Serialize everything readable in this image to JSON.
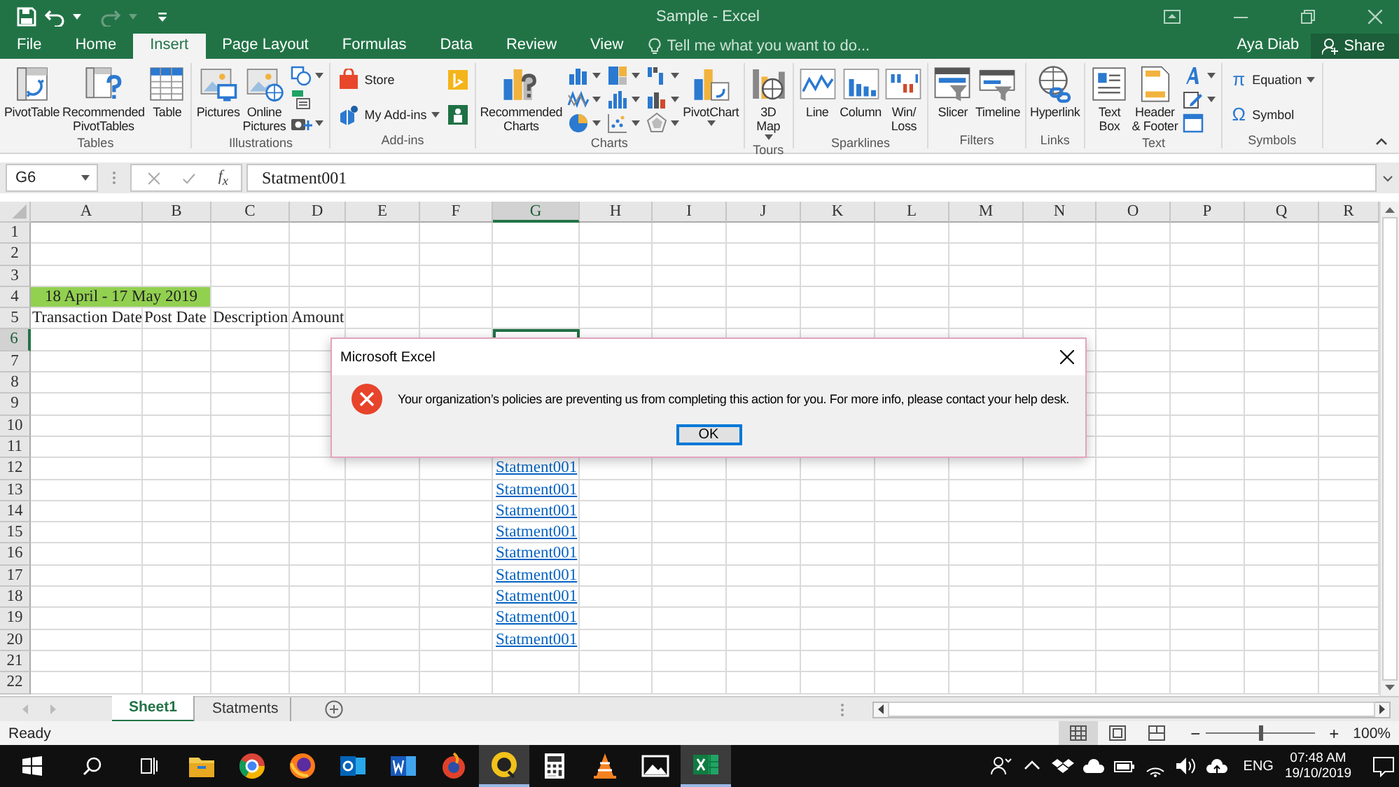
{
  "title_bar": {
    "title": "Sample - Excel"
  },
  "tabs": [
    {
      "label": "File",
      "selected": false
    },
    {
      "label": "Home",
      "selected": false
    },
    {
      "label": "Insert",
      "selected": true
    },
    {
      "label": "Page Layout",
      "selected": false
    },
    {
      "label": "Formulas",
      "selected": false
    },
    {
      "label": "Data",
      "selected": false
    },
    {
      "label": "Review",
      "selected": false
    },
    {
      "label": "View",
      "selected": false
    }
  ],
  "tell_me": {
    "placeholder": "Tell me what you want to do..."
  },
  "user": {
    "name": "Aya Diab",
    "share": "Share"
  },
  "ribbon": {
    "groups": [
      {
        "label": "Tables",
        "buttons": [
          {
            "kind": "large",
            "label": "PivotTable"
          },
          {
            "kind": "large",
            "label": "Recommended\nPivotTables"
          },
          {
            "kind": "large",
            "label": "Table"
          }
        ]
      },
      {
        "label": "Illustrations",
        "buttons": [
          {
            "kind": "large",
            "label": "Pictures"
          },
          {
            "kind": "large",
            "label": "Online\nPictures"
          },
          {
            "kind": "stack",
            "items": [
              {
                "kind": "icon",
                "dropdown": true
              },
              {
                "kind": "icon",
                "dropdown": false
              },
              {
                "kind": "icon",
                "dropdown": true
              }
            ]
          }
        ]
      },
      {
        "label": "Add-ins",
        "buttons": [
          {
            "kind": "stack",
            "items": [
              {
                "kind": "small",
                "label": "Store",
                "dropdown": false
              },
              {
                "kind": "small",
                "label": "My Add-ins",
                "dropdown": true
              }
            ]
          },
          {
            "kind": "stack",
            "items": [
              {
                "kind": "icon",
                "dropdown": false
              },
              {
                "kind": "icon",
                "dropdown": false
              }
            ]
          }
        ]
      },
      {
        "label": "Charts",
        "buttons": [
          {
            "kind": "large",
            "label": "Recommended\nCharts"
          },
          {
            "kind": "stack",
            "items": [
              {
                "kind": "icon",
                "dropdown": true
              },
              {
                "kind": "icon",
                "dropdown": true
              },
              {
                "kind": "icon",
                "dropdown": true
              }
            ]
          },
          {
            "kind": "stack",
            "items": [
              {
                "kind": "icon",
                "dropdown": true
              },
              {
                "kind": "icon",
                "dropdown": true
              },
              {
                "kind": "icon",
                "dropdown": true
              }
            ]
          },
          {
            "kind": "stack",
            "items": [
              {
                "kind": "icon",
                "dropdown": true
              },
              {
                "kind": "icon",
                "dropdown": true
              },
              {
                "kind": "icon",
                "dropdown": true
              }
            ]
          },
          {
            "kind": "large",
            "label": "PivotChart",
            "dropdown": true
          }
        ]
      },
      {
        "label": "Tours",
        "buttons": [
          {
            "kind": "large",
            "label": "3D\nMap",
            "dropdown": true
          }
        ]
      },
      {
        "label": "Sparklines",
        "buttons": [
          {
            "kind": "large",
            "label": "Line"
          },
          {
            "kind": "large",
            "label": "Column"
          },
          {
            "kind": "large",
            "label": "Win/\nLoss"
          }
        ]
      },
      {
        "label": "Filters",
        "buttons": [
          {
            "kind": "large",
            "label": "Slicer"
          },
          {
            "kind": "large",
            "label": "Timeline"
          }
        ]
      },
      {
        "label": "Links",
        "buttons": [
          {
            "kind": "large",
            "label": "Hyperlink"
          }
        ]
      },
      {
        "label": "Text",
        "buttons": [
          {
            "kind": "large",
            "label": "Text\nBox"
          },
          {
            "kind": "large",
            "label": "Header\n& Footer"
          },
          {
            "kind": "stack",
            "items": [
              {
                "kind": "icon",
                "dropdown": true
              },
              {
                "kind": "icon",
                "dropdown": true
              },
              {
                "kind": "icon",
                "dropdown": false
              }
            ]
          }
        ]
      },
      {
        "label": "Symbols",
        "buttons": [
          {
            "kind": "stack",
            "items": [
              {
                "kind": "small",
                "glyph": "π",
                "label": "Equation",
                "dropdown": true
              },
              {
                "kind": "small",
                "glyph": "Ω",
                "label": "Symbol",
                "dropdown": false
              }
            ]
          }
        ]
      }
    ]
  },
  "formula_bar": {
    "name_box": "G6",
    "fx": "f$_{x}$",
    "value": "Statment001"
  },
  "grid": {
    "columns": [
      {
        "label": "A",
        "selected": false
      },
      {
        "label": "B",
        "selected": false
      },
      {
        "label": "C",
        "selected": false
      },
      {
        "label": "D",
        "selected": false
      },
      {
        "label": "E",
        "selected": false
      },
      {
        "label": "F",
        "selected": false
      },
      {
        "label": "G",
        "selected": true
      },
      {
        "label": "H",
        "selected": false
      },
      {
        "label": "I",
        "selected": false
      },
      {
        "label": "J",
        "selected": false
      },
      {
        "label": "K",
        "selected": false
      },
      {
        "label": "L",
        "selected": false
      },
      {
        "label": "M",
        "selected": false
      },
      {
        "label": "N",
        "selected": false
      },
      {
        "label": "O",
        "selected": false
      },
      {
        "label": "P",
        "selected": false
      },
      {
        "label": "Q",
        "selected": false
      },
      {
        "label": "R",
        "selected": false
      }
    ],
    "rows": [
      {
        "label": "1",
        "selected": false,
        "cells": {}
      },
      {
        "label": "2",
        "selected": false,
        "cells": {}
      },
      {
        "label": "3",
        "selected": false,
        "cells": {}
      },
      {
        "label": "4",
        "selected": false,
        "cells": {
          "A": {
            "kind": "banner",
            "text": "18 April - 17 May 2019",
            "selected": false
          }
        }
      },
      {
        "label": "5",
        "selected": false,
        "cells": {
          "A": {
            "kind": "text",
            "text": "Transaction Date",
            "selected": false
          },
          "B": {
            "kind": "text",
            "text": "Post Date",
            "selected": false
          },
          "C": {
            "kind": "text",
            "text": "Description",
            "selected": false
          },
          "D": {
            "kind": "text",
            "text": "Amount",
            "selected": false
          }
        }
      },
      {
        "label": "6",
        "selected": true,
        "cells": {
          "G": {
            "kind": "empty",
            "selected": true
          }
        }
      },
      {
        "label": "7",
        "selected": false,
        "cells": {}
      },
      {
        "label": "8",
        "selected": false,
        "cells": {}
      },
      {
        "label": "9",
        "selected": false,
        "cells": {}
      },
      {
        "label": "10",
        "selected": false,
        "cells": {}
      },
      {
        "label": "11",
        "selected": false,
        "cells": {}
      },
      {
        "label": "12",
        "selected": false,
        "cells": {
          "G": {
            "kind": "link",
            "text": "Statment001",
            "selected": false
          }
        }
      },
      {
        "label": "13",
        "selected": false,
        "cells": {
          "G": {
            "kind": "link",
            "text": "Statment001",
            "selected": false
          }
        }
      },
      {
        "label": "14",
        "selected": false,
        "cells": {
          "G": {
            "kind": "link",
            "text": "Statment001",
            "selected": false
          }
        }
      },
      {
        "label": "15",
        "selected": false,
        "cells": {
          "G": {
            "kind": "link",
            "text": "Statment001",
            "selected": false
          }
        }
      },
      {
        "label": "16",
        "selected": false,
        "cells": {
          "G": {
            "kind": "link",
            "text": "Statment001",
            "selected": false
          }
        }
      },
      {
        "label": "17",
        "selected": false,
        "cells": {
          "G": {
            "kind": "link",
            "text": "Statment001",
            "selected": false
          }
        }
      },
      {
        "label": "18",
        "selected": false,
        "cells": {
          "G": {
            "kind": "link",
            "text": "Statment001",
            "selected": false
          }
        }
      },
      {
        "label": "19",
        "selected": false,
        "cells": {
          "G": {
            "kind": "link",
            "text": "Statment001",
            "selected": false
          }
        }
      },
      {
        "label": "20",
        "selected": false,
        "cells": {
          "G": {
            "kind": "link",
            "text": "Statment001",
            "selected": false
          }
        }
      },
      {
        "label": "21",
        "selected": false,
        "cells": {}
      },
      {
        "label": "22",
        "selected": false,
        "cells": {}
      }
    ]
  },
  "dialog": {
    "title": "Microsoft Excel",
    "message": "Your organization’s policies are preventing us from completing this action for you. For more info, please contact your help desk.",
    "button": "OK"
  },
  "sheet_tabs": [
    {
      "label": "Sheet1",
      "selected": true
    },
    {
      "label": "Statments",
      "selected": false
    }
  ],
  "status_bar": {
    "status": "Ready",
    "views": [
      {
        "selected": true
      },
      {
        "selected": false
      },
      {
        "selected": false
      }
    ],
    "zoom_out": "−",
    "zoom_in": "+",
    "zoom": {
      "level": 0.5
    },
    "zoom_label": "100%"
  },
  "taskbar": {
    "apps": [
      {
        "active": false
      },
      {
        "active": false
      },
      {
        "active": false
      },
      {
        "active": false
      },
      {
        "active": false
      },
      {
        "active": false
      },
      {
        "active": true
      },
      {
        "active": false
      },
      {
        "active": false
      },
      {
        "active": false
      },
      {
        "active": true
      }
    ],
    "language": "ENG",
    "time": "07:48 AM",
    "date": "19/10/2019"
  }
}
